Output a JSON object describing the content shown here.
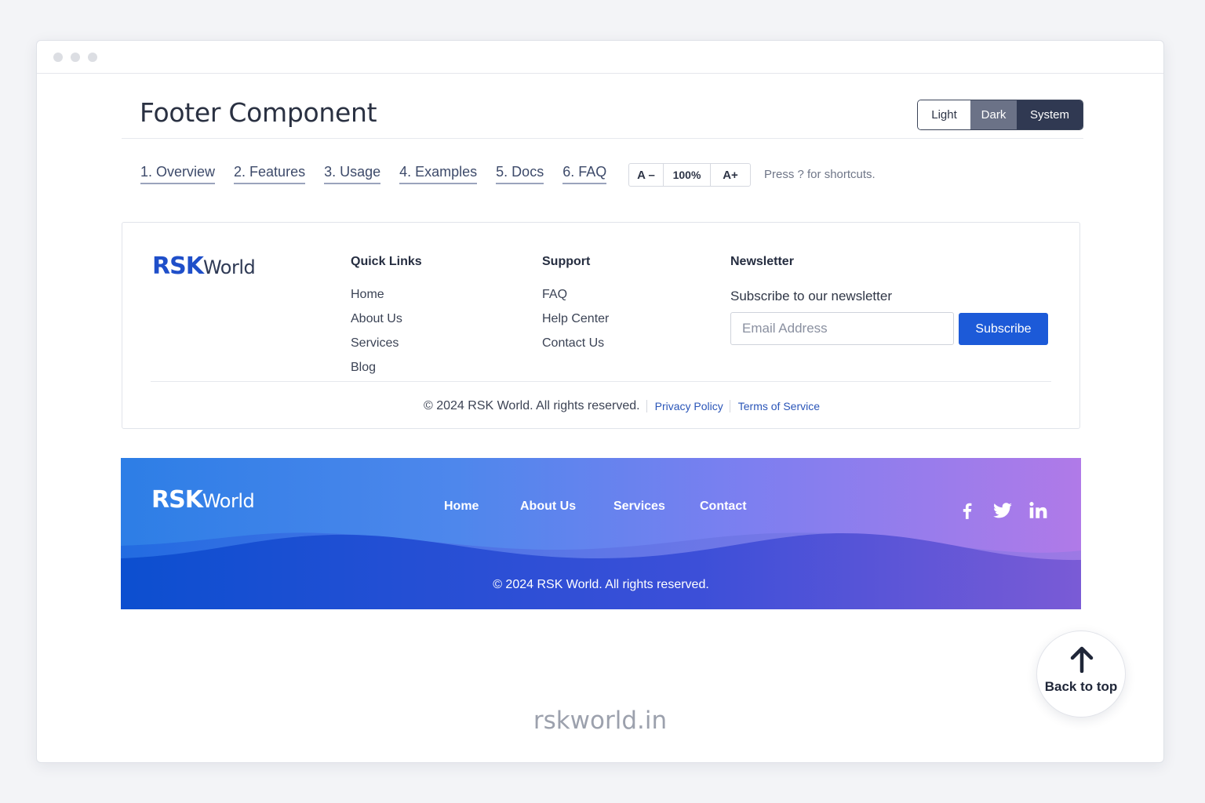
{
  "page": {
    "title": "Footer Component",
    "theme_options": [
      "Light",
      "Dark",
      "System"
    ],
    "tabs": [
      "1. Overview",
      "2. Features",
      "3. Usage",
      "4. Examples",
      "5. Docs",
      "6. FAQ"
    ],
    "font_controls": {
      "decrease": "A –",
      "zoom": "100%",
      "increase": "A+"
    },
    "shortcuts_hint": "Press ? for shortcuts."
  },
  "footer_light": {
    "logo": {
      "bold": "RSK",
      "rest": "World"
    },
    "quick_links": {
      "title": "Quick Links",
      "items": [
        "Home",
        "About Us",
        "Services",
        "Blog"
      ]
    },
    "support": {
      "title": "Support",
      "items": [
        "FAQ",
        "Help Center",
        "Contact Us"
      ]
    },
    "newsletter": {
      "title": "Newsletter",
      "subtitle": "Subscribe to our newsletter",
      "email_placeholder": "Email Address",
      "button": "Subscribe"
    },
    "copyright": "© 2024 RSK World. All rights reserved.",
    "links": [
      "Privacy Policy",
      "Terms of Service"
    ]
  },
  "footer_gradient": {
    "logo": {
      "bold": "RSK",
      "rest": "World"
    },
    "nav": [
      "Home",
      "About Us",
      "Services",
      "Contact"
    ],
    "social": [
      "facebook-icon",
      "twitter-icon",
      "linkedin-icon"
    ],
    "copyright": "© 2024 RSK World. All rights reserved."
  },
  "back_to_top": "Back to top",
  "watermark": "rskworld.in",
  "colors": {
    "accent_blue": "#1c5ad8",
    "gradient_start": "#2d7ee6",
    "gradient_end": "#b07ae8"
  }
}
